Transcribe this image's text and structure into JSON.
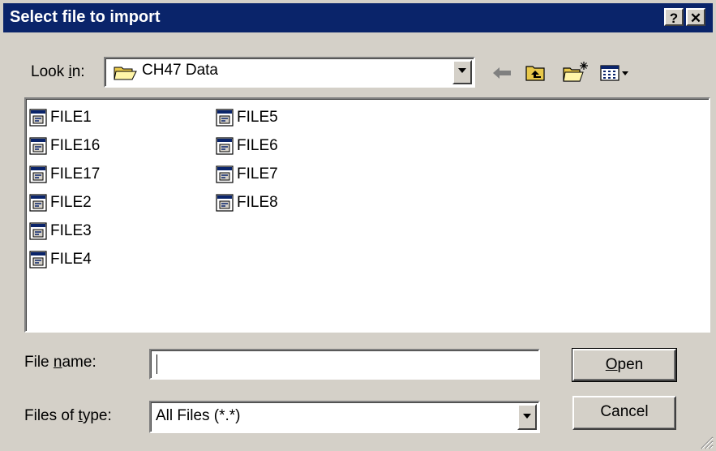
{
  "window": {
    "title": "Select file to import",
    "help_label": "?",
    "close_label": "✕"
  },
  "look_in": {
    "label_pre": "Look ",
    "label_u": "i",
    "label_post": "n:",
    "value": "CH47 Data",
    "icon": "folder-icon"
  },
  "toolbar": {
    "back_icon": "back-arrow-icon",
    "up_icon": "up-one-level-icon",
    "new_folder_icon": "new-folder-icon",
    "view_menu_icon": "view-menu-icon"
  },
  "files": {
    "icon": "file-icon",
    "columns": [
      [
        {
          "name": "FILE1"
        },
        {
          "name": "FILE16"
        },
        {
          "name": "FILE17"
        },
        {
          "name": "FILE2"
        },
        {
          "name": "FILE3"
        },
        {
          "name": "FILE4"
        }
      ],
      [
        {
          "name": "FILE5"
        },
        {
          "name": "FILE6"
        },
        {
          "name": "FILE7"
        },
        {
          "name": "FILE8"
        }
      ]
    ]
  },
  "file_name": {
    "label_pre": "File ",
    "label_u": "n",
    "label_post": "ame:",
    "value": ""
  },
  "file_type": {
    "label_pre": "Files of ",
    "label_u": "t",
    "label_post": "ype:",
    "value": "All Files (*.*)"
  },
  "buttons": {
    "open_u": "O",
    "open_rest": "pen",
    "cancel": "Cancel"
  }
}
